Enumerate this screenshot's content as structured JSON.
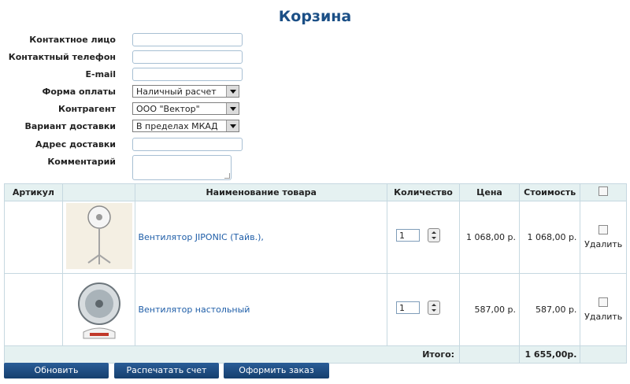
{
  "page": {
    "title": "Корзина"
  },
  "form": {
    "contact_person": {
      "label": "Контактное лицо",
      "value": ""
    },
    "phone": {
      "label": "Контактный телефон",
      "value": ""
    },
    "email": {
      "label": "E-mail",
      "value": ""
    },
    "payment": {
      "label": "Форма оплаты",
      "value": "Наличный расчет"
    },
    "counterparty": {
      "label": "Контрагент",
      "value": "ООО \"Вектор\""
    },
    "delivery": {
      "label": "Вариант доставки",
      "value": "В пределах МКАД"
    },
    "address": {
      "label": "Адрес доставки",
      "value": ""
    },
    "comment": {
      "label": "Комментарий",
      "value": ""
    }
  },
  "table": {
    "headers": {
      "article": "Артикул",
      "name": "Наименование товара",
      "quantity": "Количество",
      "price": "Цена",
      "cost": "Стоимость"
    },
    "rows": [
      {
        "article": "",
        "image": "stand-fan",
        "name": "Вентилятор JIPONIC (Тайв.),",
        "quantity": "1",
        "price": "1 068,00 р.",
        "cost": "1 068,00 р.",
        "delete_label": "Удалить"
      },
      {
        "article": "",
        "image": "desk-fan",
        "name": "Вентилятор настольный",
        "quantity": "1",
        "price": "587,00 р.",
        "cost": "587,00 р.",
        "delete_label": "Удалить"
      }
    ],
    "total": {
      "label": "Итого:",
      "value": "1 655,00р."
    }
  },
  "buttons": {
    "update": "Обновить",
    "print": "Распечатать счет",
    "order": "Оформить заказ"
  },
  "colors": {
    "title": "#1b4f86",
    "link": "#1f5ea8",
    "header_bg": "#e5f1f1",
    "button_bg": "#1f4f85"
  }
}
